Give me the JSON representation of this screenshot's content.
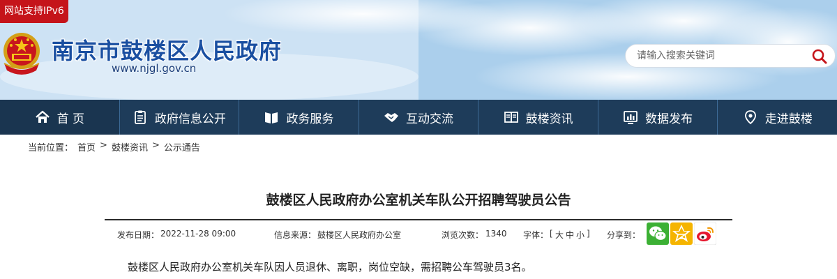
{
  "header": {
    "ipv6_badge": "网站支持IPv6",
    "site_title": "南京市鼓楼区人民政府",
    "site_url": "www.njgl.gov.cn",
    "search_placeholder": "请输入搜索关键词"
  },
  "nav": {
    "items": [
      {
        "label": "首 页",
        "icon": "home-icon"
      },
      {
        "label": "政府信息公开",
        "icon": "document-icon"
      },
      {
        "label": "政务服务",
        "icon": "book-icon"
      },
      {
        "label": "互动交流",
        "icon": "handshake-icon"
      },
      {
        "label": "鼓楼资讯",
        "icon": "news-icon"
      },
      {
        "label": "数据发布",
        "icon": "chart-icon"
      },
      {
        "label": "走进鼓楼",
        "icon": "location-icon"
      }
    ]
  },
  "breadcrumb": {
    "prefix": "当前位置：",
    "items": [
      "首页",
      "鼓楼资讯",
      "公示通告"
    ],
    "separator": ">"
  },
  "article": {
    "title": "鼓楼区人民政府办公室机关车队公开招聘驾驶员公告",
    "publish_date_label": "发布日期：",
    "publish_date": "2022-11-28 09:00",
    "source_label": "信息来源：",
    "source": "鼓楼区人民政府办公室",
    "views_label": "浏览次数：",
    "views": "1340",
    "font_label": "字体：",
    "font_open": "[",
    "font_large": "大",
    "font_medium": "中",
    "font_small": "小",
    "font_close": "]",
    "share_label": "分享到：",
    "share_targets": [
      "wechat-icon",
      "qzone-icon",
      "weibo-icon"
    ],
    "body_first_line": "鼓楼区人民政府办公室机关车队因人员退休、离职，岗位空缺，需招聘公车驾驶员3名。"
  },
  "colors": {
    "nav_bg": "#1e3c5a",
    "title_blue": "#1a4fa1",
    "ipv6_red": "#c5141a",
    "search_icon_red": "#c5141a"
  }
}
